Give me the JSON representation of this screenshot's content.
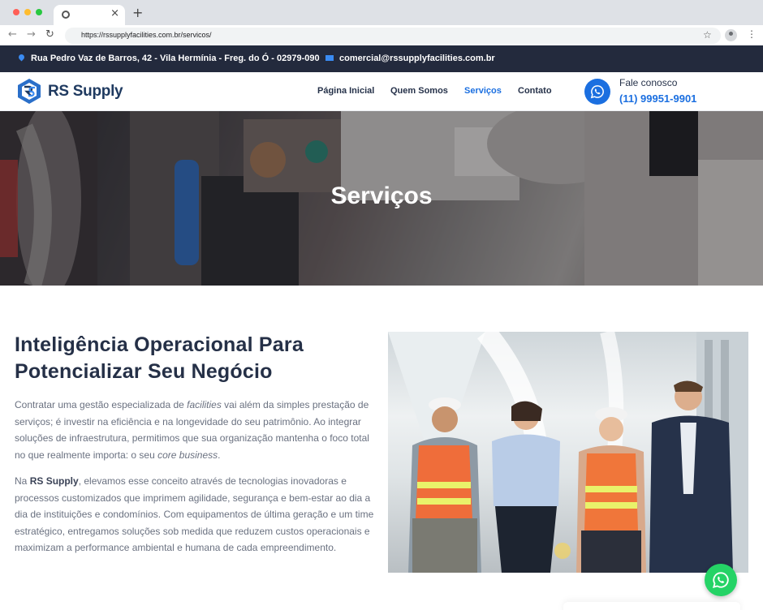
{
  "browser": {
    "url": "https://rssupplyfacilities.com.br/servicos/",
    "new_tab_symbol": "+",
    "close_symbol": "×",
    "back_symbol": "←",
    "forward_symbol": "→",
    "reload_symbol": "↻",
    "star_symbol": "☆",
    "menu_symbol": "⋮"
  },
  "topbar": {
    "address": "Rua Pedro Vaz de Barros, 42 - Vila Hermínia - Freg. do Ó - 02979-090",
    "email": "comercial@rssupplyfacilities.com.br",
    "address_icon": "map-pin-icon",
    "email_icon": "envelope-icon"
  },
  "header": {
    "logo_text": "RS Supply",
    "nav": [
      {
        "label": "Página Inicial",
        "active": false
      },
      {
        "label": "Quem Somos",
        "active": false
      },
      {
        "label": "Serviços",
        "active": true
      },
      {
        "label": "Contato",
        "active": false
      }
    ],
    "contact_label": "Fale conosco",
    "contact_phone": "(11) 99951-9901",
    "contact_icon": "whatsapp-icon"
  },
  "hero": {
    "title": "Serviços"
  },
  "content": {
    "heading": "Inteligência Operacional Para Potencializar Seu Negócio",
    "p1_a": "Contratar uma gestão especializada de ",
    "p1_em1": "facilities",
    "p1_b": " vai além da simples prestação de serviços; é investir na eficiência e na longevidade do seu patrimônio. Ao integrar soluções de infraestrutura, permitimos que sua organização mantenha o foco total no que realmente importa: o seu ",
    "p1_em2": "core business",
    "p1_c": ".",
    "p2_a": "Na ",
    "p2_strong": "RS Supply",
    "p2_b": ", elevamos esse conceito através de tecnologias inovadoras e processos customizados que imprimem agilidade, segurança e bem-estar ao dia a dia de instituições e condomínios. Com equipamentos de última geração e um time estratégico, entregamos soluções sob medida que reduzem custos operacionais e maximizam a performance ambiental e humana de cada empreendimento."
  },
  "colors": {
    "brand_blue": "#1b6fe0",
    "dark_navy": "#232a3d",
    "whatsapp_green": "#25d366"
  }
}
